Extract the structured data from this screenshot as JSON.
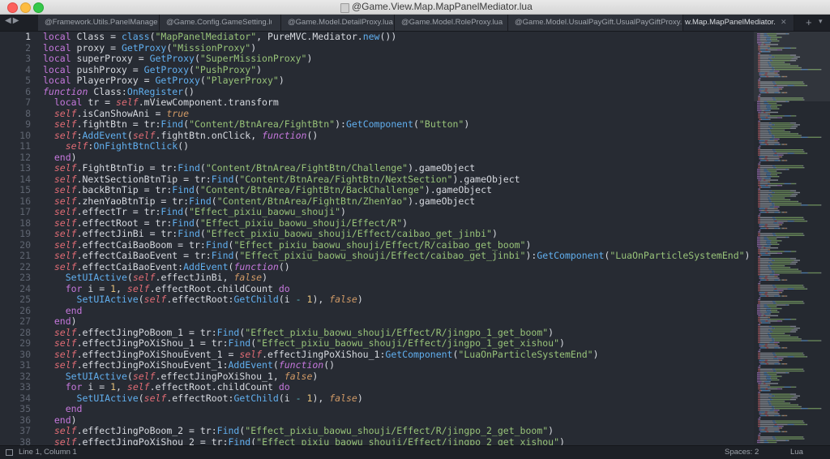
{
  "window": {
    "title": "@Game.View.Map.MapPanelMediator.lua"
  },
  "tabs": [
    {
      "label": "@Framework.Utils.PanelManager.lua"
    },
    {
      "label": "@Game.Config.GameSetting.lua"
    },
    {
      "label": "@Game.Model.DetailProxy.lua"
    },
    {
      "label": "@Game.Model.RoleProxy.lua"
    },
    {
      "label": "@Game.Model.UsualPayGift.UsualPayGiftProxy.lua"
    },
    {
      "label": "@Game.View.Map.MapPanelMediator.lua",
      "shown": "w.Map.MapPanelMediator.lua",
      "active": true
    }
  ],
  "tab_bar": {
    "back": "◀",
    "forward": "▶",
    "new_tab": "+",
    "menu": "▾",
    "close": "✕"
  },
  "editor": {
    "current_line": 1,
    "lines": [
      [
        [
          "k",
          "local "
        ],
        [
          "n",
          "Class = "
        ],
        [
          "f",
          "class"
        ],
        [
          "n",
          "("
        ],
        [
          "s",
          "\"MapPanelMediator\""
        ],
        [
          "n",
          ", PureMVC.Mediator."
        ],
        [
          "f",
          "new"
        ],
        [
          "n",
          "())"
        ]
      ],
      [
        [
          "k",
          "local "
        ],
        [
          "n",
          "proxy = "
        ],
        [
          "f",
          "GetProxy"
        ],
        [
          "n",
          "("
        ],
        [
          "s",
          "\"MissionProxy\""
        ],
        [
          "n",
          ")"
        ]
      ],
      [
        [
          "k",
          "local "
        ],
        [
          "n",
          "superProxy = "
        ],
        [
          "f",
          "GetProxy"
        ],
        [
          "n",
          "("
        ],
        [
          "s",
          "\"SuperMissionProxy\""
        ],
        [
          "n",
          ")"
        ]
      ],
      [
        [
          "k",
          "local "
        ],
        [
          "n",
          "pushProxy = "
        ],
        [
          "f",
          "GetProxy"
        ],
        [
          "n",
          "("
        ],
        [
          "s",
          "\"PushProxy\""
        ],
        [
          "n",
          ")"
        ]
      ],
      [
        [
          "k",
          "local "
        ],
        [
          "n",
          "PlayerProxy = "
        ],
        [
          "f",
          "GetProxy"
        ],
        [
          "n",
          "("
        ],
        [
          "s",
          "\"PlayerProxy\""
        ],
        [
          "n",
          ")"
        ]
      ],
      [
        [
          "fi",
          "function "
        ],
        [
          "n",
          "Class:"
        ],
        [
          "f",
          "OnRegister"
        ],
        [
          "n",
          "()"
        ]
      ],
      [
        [
          "n",
          "  "
        ],
        [
          "k",
          "local "
        ],
        [
          "n",
          "tr = "
        ],
        [
          "sf",
          "self"
        ],
        [
          "n",
          ".mViewComponent.transform"
        ]
      ],
      [
        [
          "n",
          "  "
        ],
        [
          "sf",
          "self"
        ],
        [
          "n",
          ".isCanShowAni = "
        ],
        [
          "b",
          "true"
        ]
      ],
      [
        [
          "n",
          "  "
        ],
        [
          "sf",
          "self"
        ],
        [
          "n",
          ".fightBtn = tr:"
        ],
        [
          "f",
          "Find"
        ],
        [
          "n",
          "("
        ],
        [
          "s",
          "\"Content/BtnArea/FightBtn\""
        ],
        [
          "n",
          "):"
        ],
        [
          "f",
          "GetComponent"
        ],
        [
          "n",
          "("
        ],
        [
          "s",
          "\"Button\""
        ],
        [
          "n",
          ")"
        ]
      ],
      [
        [
          "n",
          "  "
        ],
        [
          "sf",
          "self"
        ],
        [
          "n",
          ":"
        ],
        [
          "f",
          "AddEvent"
        ],
        [
          "n",
          "("
        ],
        [
          "sf",
          "self"
        ],
        [
          "n",
          ".fightBtn.onClick, "
        ],
        [
          "fi",
          "function"
        ],
        [
          "n",
          "()"
        ]
      ],
      [
        [
          "n",
          "    "
        ],
        [
          "sf",
          "self"
        ],
        [
          "n",
          ":"
        ],
        [
          "f",
          "OnFightBtnClick"
        ],
        [
          "n",
          "()"
        ]
      ],
      [
        [
          "n",
          "  "
        ],
        [
          "k",
          "end"
        ],
        [
          "n",
          ")"
        ]
      ],
      [
        [
          "n",
          "  "
        ],
        [
          "sf",
          "self"
        ],
        [
          "n",
          ".FightBtnTip = tr:"
        ],
        [
          "f",
          "Find"
        ],
        [
          "n",
          "("
        ],
        [
          "s",
          "\"Content/BtnArea/FightBtn/Challenge\""
        ],
        [
          "n",
          ").gameObject"
        ]
      ],
      [
        [
          "n",
          "  "
        ],
        [
          "sf",
          "self"
        ],
        [
          "n",
          ".NextSectionBtnTip = tr:"
        ],
        [
          "f",
          "Find"
        ],
        [
          "n",
          "("
        ],
        [
          "s",
          "\"Content/BtnArea/FightBtn/NextSection\""
        ],
        [
          "n",
          ").gameObject"
        ]
      ],
      [
        [
          "n",
          "  "
        ],
        [
          "sf",
          "self"
        ],
        [
          "n",
          ".backBtnTip = tr:"
        ],
        [
          "f",
          "Find"
        ],
        [
          "n",
          "("
        ],
        [
          "s",
          "\"Content/BtnArea/FightBtn/BackChallenge\""
        ],
        [
          "n",
          ").gameObject"
        ]
      ],
      [
        [
          "n",
          "  "
        ],
        [
          "sf",
          "self"
        ],
        [
          "n",
          ".zhenYaoBtnTip = tr:"
        ],
        [
          "f",
          "Find"
        ],
        [
          "n",
          "("
        ],
        [
          "s",
          "\"Content/BtnArea/FightBtn/ZhenYao\""
        ],
        [
          "n",
          ").gameObject"
        ]
      ],
      [
        [
          "n",
          "  "
        ],
        [
          "sf",
          "self"
        ],
        [
          "n",
          ".effectTr = tr:"
        ],
        [
          "f",
          "Find"
        ],
        [
          "n",
          "("
        ],
        [
          "s",
          "\"Effect_pixiu_baowu_shouji\""
        ],
        [
          "n",
          ")"
        ]
      ],
      [
        [
          "n",
          "  "
        ],
        [
          "sf",
          "self"
        ],
        [
          "n",
          ".effectRoot = tr:"
        ],
        [
          "f",
          "Find"
        ],
        [
          "n",
          "("
        ],
        [
          "s",
          "\"Effect_pixiu_baowu_shouji/Effect/R\""
        ],
        [
          "n",
          ")"
        ]
      ],
      [
        [
          "n",
          "  "
        ],
        [
          "sf",
          "self"
        ],
        [
          "n",
          ".effectJinBi = tr:"
        ],
        [
          "f",
          "Find"
        ],
        [
          "n",
          "("
        ],
        [
          "s",
          "\"Effect_pixiu_baowu_shouji/Effect/caibao_get_jinbi\""
        ],
        [
          "n",
          ")"
        ]
      ],
      [
        [
          "n",
          "  "
        ],
        [
          "sf",
          "self"
        ],
        [
          "n",
          ".effectCaiBaoBoom = tr:"
        ],
        [
          "f",
          "Find"
        ],
        [
          "n",
          "("
        ],
        [
          "s",
          "\"Effect_pixiu_baowu_shouji/Effect/R/caibao_get_boom\""
        ],
        [
          "n",
          ")"
        ]
      ],
      [
        [
          "n",
          "  "
        ],
        [
          "sf",
          "self"
        ],
        [
          "n",
          ".effectCaiBaoEvent = tr:"
        ],
        [
          "f",
          "Find"
        ],
        [
          "n",
          "("
        ],
        [
          "s",
          "\"Effect_pixiu_baowu_shouji/Effect/caibao_get_jinbi\""
        ],
        [
          "n",
          "):"
        ],
        [
          "f",
          "GetComponent"
        ],
        [
          "n",
          "("
        ],
        [
          "s",
          "\"LuaOnParticleSystemEnd\""
        ],
        [
          "n",
          ")"
        ]
      ],
      [
        [
          "n",
          "  "
        ],
        [
          "sf",
          "self"
        ],
        [
          "n",
          ".effectCaiBaoEvent:"
        ],
        [
          "f",
          "AddEvent"
        ],
        [
          "n",
          "("
        ],
        [
          "fi",
          "function"
        ],
        [
          "n",
          "()"
        ]
      ],
      [
        [
          "n",
          "    "
        ],
        [
          "f",
          "SetUIActive"
        ],
        [
          "n",
          "("
        ],
        [
          "sf",
          "self"
        ],
        [
          "n",
          ".effectJinBi, "
        ],
        [
          "b",
          "false"
        ],
        [
          "n",
          ")"
        ]
      ],
      [
        [
          "n",
          "    "
        ],
        [
          "k",
          "for "
        ],
        [
          "n",
          "i = "
        ],
        [
          "t",
          "1"
        ],
        [
          "n",
          ", "
        ],
        [
          "sf",
          "self"
        ],
        [
          "n",
          ".effectRoot.childCount "
        ],
        [
          "k",
          "do"
        ]
      ],
      [
        [
          "n",
          "      "
        ],
        [
          "f",
          "SetUIActive"
        ],
        [
          "n",
          "("
        ],
        [
          "sf",
          "self"
        ],
        [
          "n",
          ".effectRoot:"
        ],
        [
          "f",
          "GetChild"
        ],
        [
          "n",
          "(i "
        ],
        [
          "d",
          "-"
        ],
        [
          "n",
          " "
        ],
        [
          "t",
          "1"
        ],
        [
          "n",
          "), "
        ],
        [
          "b",
          "false"
        ],
        [
          "n",
          ")"
        ]
      ],
      [
        [
          "n",
          "    "
        ],
        [
          "k",
          "end"
        ]
      ],
      [
        [
          "n",
          "  "
        ],
        [
          "k",
          "end"
        ],
        [
          "n",
          ")"
        ]
      ],
      [
        [
          "n",
          "  "
        ],
        [
          "sf",
          "self"
        ],
        [
          "n",
          ".effectJingPoBoom_1 = tr:"
        ],
        [
          "f",
          "Find"
        ],
        [
          "n",
          "("
        ],
        [
          "s",
          "\"Effect_pixiu_baowu_shouji/Effect/R/jingpo_1_get_boom\""
        ],
        [
          "n",
          ")"
        ]
      ],
      [
        [
          "n",
          "  "
        ],
        [
          "sf",
          "self"
        ],
        [
          "n",
          ".effectJingPoXiShou_1 = tr:"
        ],
        [
          "f",
          "Find"
        ],
        [
          "n",
          "("
        ],
        [
          "s",
          "\"Effect_pixiu_baowu_shouji/Effect/jingpo_1_get_xishou\""
        ],
        [
          "n",
          ")"
        ]
      ],
      [
        [
          "n",
          "  "
        ],
        [
          "sf",
          "self"
        ],
        [
          "n",
          ".effectJingPoXiShouEvent_1 = "
        ],
        [
          "sf",
          "self"
        ],
        [
          "n",
          ".effectJingPoXiShou_1:"
        ],
        [
          "f",
          "GetComponent"
        ],
        [
          "n",
          "("
        ],
        [
          "s",
          "\"LuaOnParticleSystemEnd\""
        ],
        [
          "n",
          ")"
        ]
      ],
      [
        [
          "n",
          "  "
        ],
        [
          "sf",
          "self"
        ],
        [
          "n",
          ".effectJingPoXiShouEvent_1:"
        ],
        [
          "f",
          "AddEvent"
        ],
        [
          "n",
          "("
        ],
        [
          "fi",
          "function"
        ],
        [
          "n",
          "()"
        ]
      ],
      [
        [
          "n",
          "    "
        ],
        [
          "f",
          "SetUIActive"
        ],
        [
          "n",
          "("
        ],
        [
          "sf",
          "self"
        ],
        [
          "n",
          ".effectJingPoXiShou_1, "
        ],
        [
          "b",
          "false"
        ],
        [
          "n",
          ")"
        ]
      ],
      [
        [
          "n",
          "    "
        ],
        [
          "k",
          "for "
        ],
        [
          "n",
          "i = "
        ],
        [
          "t",
          "1"
        ],
        [
          "n",
          ", "
        ],
        [
          "sf",
          "self"
        ],
        [
          "n",
          ".effectRoot.childCount "
        ],
        [
          "k",
          "do"
        ]
      ],
      [
        [
          "n",
          "      "
        ],
        [
          "f",
          "SetUIActive"
        ],
        [
          "n",
          "("
        ],
        [
          "sf",
          "self"
        ],
        [
          "n",
          ".effectRoot:"
        ],
        [
          "f",
          "GetChild"
        ],
        [
          "n",
          "(i "
        ],
        [
          "d",
          "-"
        ],
        [
          "n",
          " "
        ],
        [
          "t",
          "1"
        ],
        [
          "n",
          "), "
        ],
        [
          "b",
          "false"
        ],
        [
          "n",
          ")"
        ]
      ],
      [
        [
          "n",
          "    "
        ],
        [
          "k",
          "end"
        ]
      ],
      [
        [
          "n",
          "  "
        ],
        [
          "k",
          "end"
        ],
        [
          "n",
          ")"
        ]
      ],
      [
        [
          "n",
          "  "
        ],
        [
          "sf",
          "self"
        ],
        [
          "n",
          ".effectJingPoBoom_2 = tr:"
        ],
        [
          "f",
          "Find"
        ],
        [
          "n",
          "("
        ],
        [
          "s",
          "\"Effect_pixiu_baowu_shouji/Effect/R/jingpo_2_get_boom\""
        ],
        [
          "n",
          ")"
        ]
      ],
      [
        [
          "n",
          "  "
        ],
        [
          "sf",
          "self"
        ],
        [
          "n",
          ".effectJingPoXiShou_2 = tr:"
        ],
        [
          "f",
          "Find"
        ],
        [
          "n",
          "("
        ],
        [
          "s",
          "\"Effect_pixiu_baowu_shouji/Effect/jingpo_2_get_xishou\""
        ],
        [
          "n",
          ")"
        ]
      ]
    ]
  },
  "status_bar": {
    "position": "Line 1, Column 1",
    "indent": "Spaces: 2",
    "syntax": "Lua"
  }
}
